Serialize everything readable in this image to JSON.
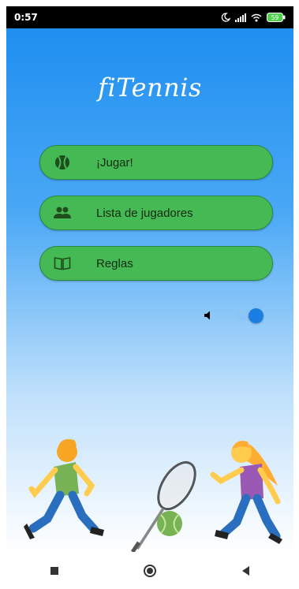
{
  "status_bar": {
    "time": "0:57",
    "battery_level": "59"
  },
  "app": {
    "title": "fiTennis"
  },
  "menu": {
    "items": [
      {
        "label": "¡Jugar!",
        "icon": "tennis-ball-icon"
      },
      {
        "label": "Lista de jugadores",
        "icon": "people-icon"
      },
      {
        "label": "Reglas",
        "icon": "book-icon"
      }
    ]
  },
  "sound": {
    "icon": "volume-icon",
    "enabled": true
  },
  "colors": {
    "button_green": "#45b953",
    "sky_top": "#1f8ff0",
    "toggle_blue": "#1b7fe2"
  },
  "nav": {
    "items": [
      "recent-apps-button",
      "home-button",
      "back-button"
    ]
  }
}
